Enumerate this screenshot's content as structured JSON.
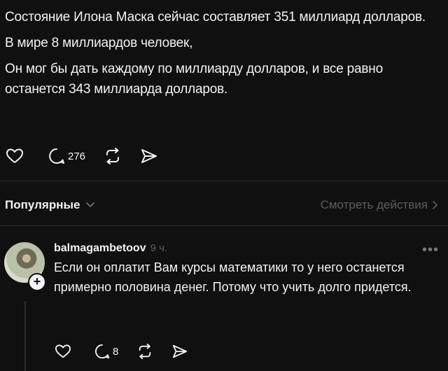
{
  "post": {
    "paragraphs": [
      "Состояние Илона Маска сейчас составляет 351 миллиард долларов.",
      "В мире 8 миллиардов человек,",
      "Он мог бы дать каждому по миллиарду долларов, и все равно останется 343 миллиарда долларов."
    ],
    "actions": {
      "comments_count": "276"
    }
  },
  "replies_header": {
    "sort_label": "Популярные",
    "view_activity_label": "Смотреть действия"
  },
  "reply": {
    "username": "balmagambetoov",
    "time": "9 ч.",
    "text": "Если он оплатит Вам курсы математики то у него останется примерно половина денег. Потому что учить долго придется.",
    "actions": {
      "comments_count": "8"
    }
  },
  "icons": {
    "like": "heart-outline-icon",
    "comment": "comment-bubble-icon",
    "repost": "repost-arrows-icon",
    "share": "send-icon",
    "more": "more-dots-icon",
    "follow": "plus-icon"
  }
}
